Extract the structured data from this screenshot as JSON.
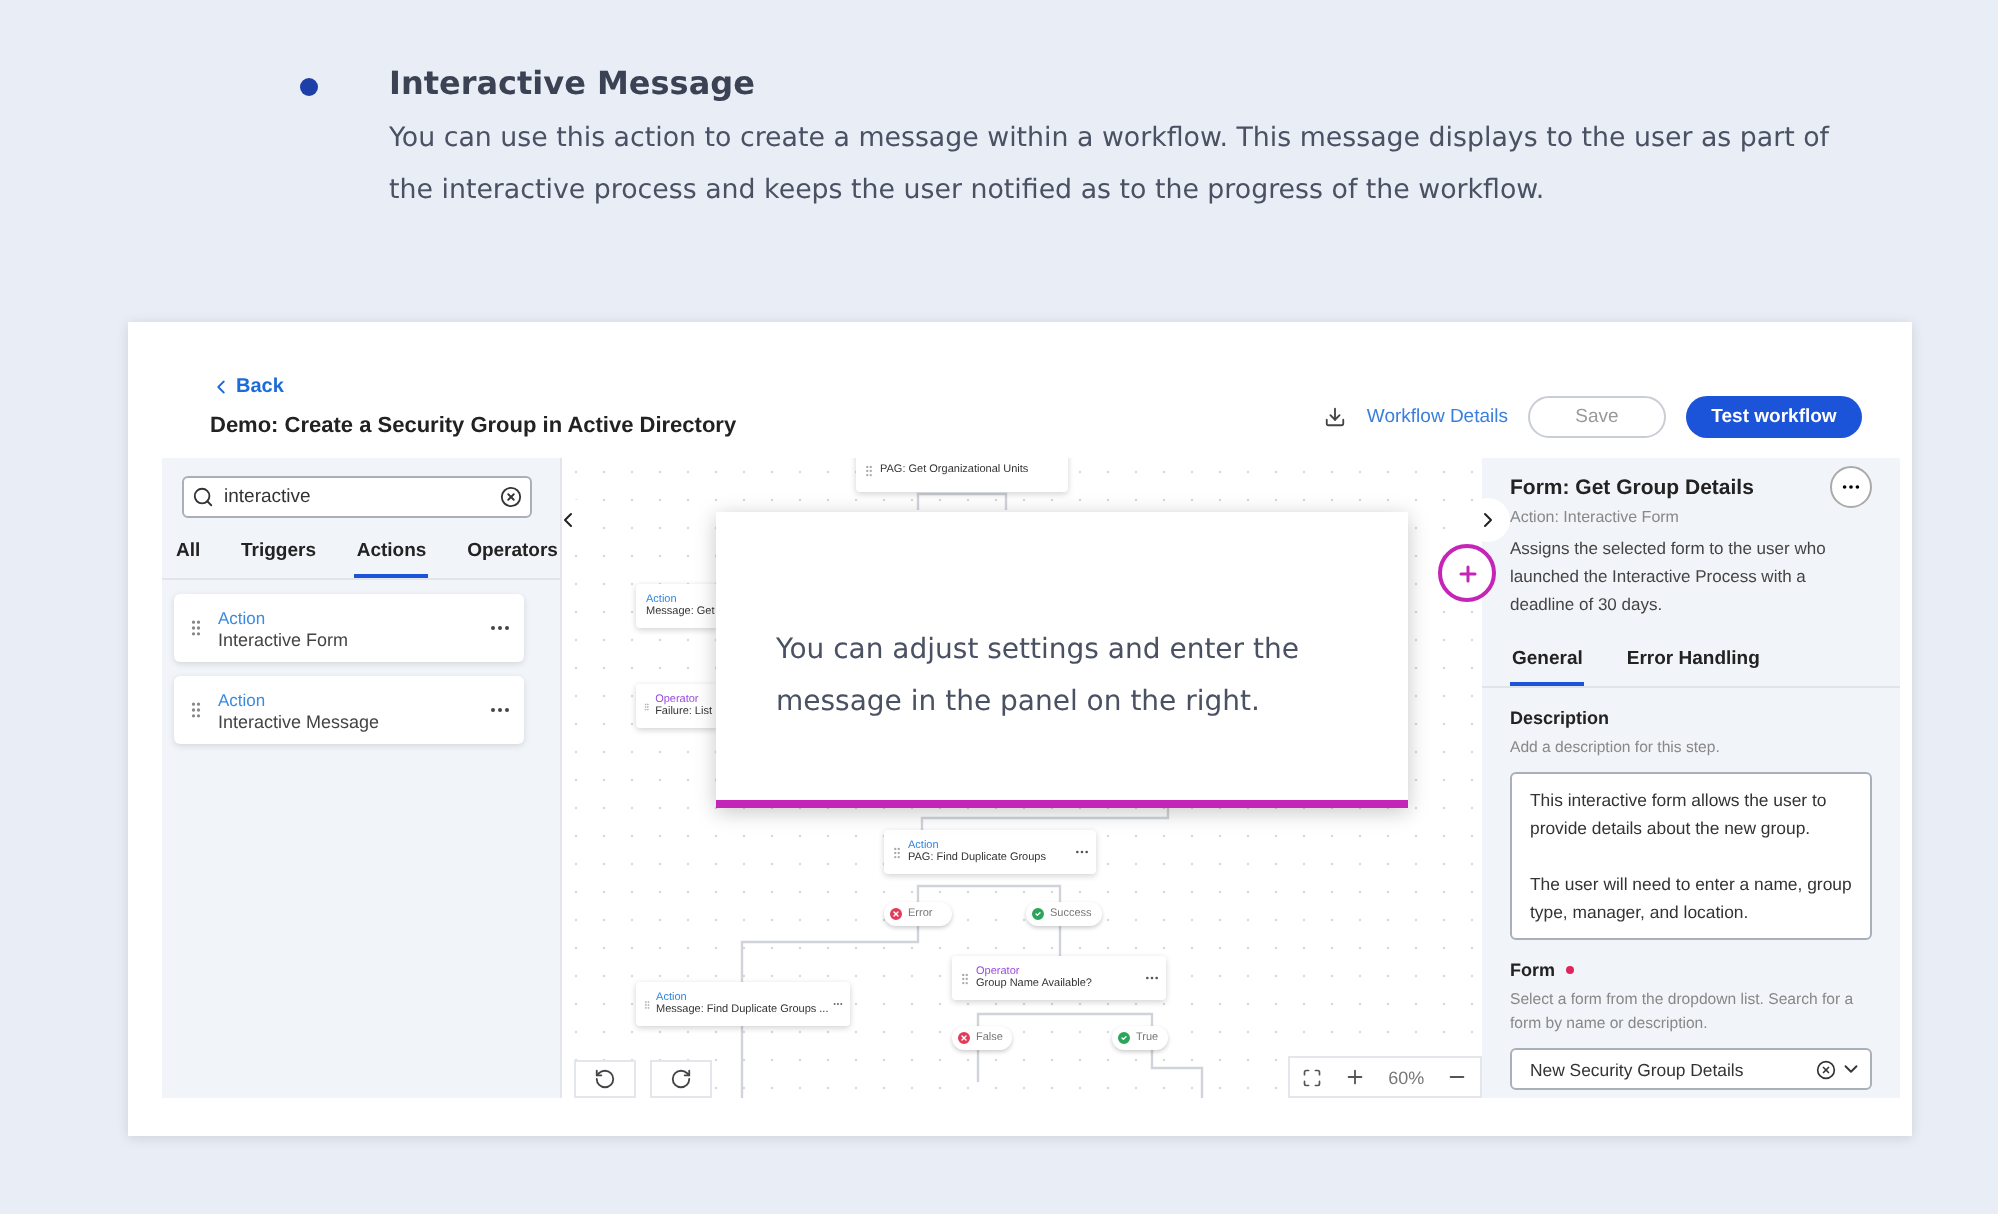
{
  "intro": {
    "title": "Interactive Message",
    "text": "You can use this action to create a message within a workflow. This message displays to the user as part of the interactive process and keeps the user notified as to the progress of the workflow."
  },
  "header": {
    "back": "Back",
    "title": "Demo: Create a Security Group in Active Directory",
    "details_link": "Workflow Details",
    "save": "Save",
    "test": "Test workflow"
  },
  "left_panel": {
    "search": {
      "value": "interactive"
    },
    "tabs": [
      {
        "label": "All",
        "selected": false
      },
      {
        "label": "Triggers",
        "selected": false
      },
      {
        "label": "Actions",
        "selected": true
      },
      {
        "label": "Operators",
        "selected": false
      }
    ],
    "items": [
      {
        "type": "Action",
        "name": "Interactive Form"
      },
      {
        "type": "Action",
        "name": "Interactive Message"
      }
    ]
  },
  "canvas": {
    "nodes": [
      {
        "kind": "plain",
        "name": "PAG: Get Organizational Units"
      },
      {
        "kind": "action",
        "type": "Action",
        "name": "Message: Get"
      },
      {
        "kind": "operator",
        "type": "Operator",
        "name": "Failure: List"
      },
      {
        "kind": "action",
        "type": "Action",
        "name": "PAG: Find Duplicate Groups"
      },
      {
        "kind": "operator",
        "type": "Operator",
        "name": "Group Name Available?"
      },
      {
        "kind": "action",
        "type": "Action",
        "name": "Message: Find Duplicate Groups ..."
      }
    ],
    "branches": [
      {
        "kind": "fail",
        "label": "Error"
      },
      {
        "kind": "pass",
        "label": "Success"
      },
      {
        "kind": "fail",
        "label": "False"
      },
      {
        "kind": "pass",
        "label": "True"
      }
    ],
    "zoom": "60%",
    "tooltip": "You can adjust settings and enter the message in the panel on the right."
  },
  "right_panel": {
    "title": "Form: Get Group Details",
    "subtitle": "Action: Interactive Form",
    "description": "Assigns the selected form to the user who launched the Interactive Process with a deadline of 30 days.",
    "tabs": [
      {
        "label": "General",
        "selected": true
      },
      {
        "label": "Error Handling",
        "selected": false
      }
    ],
    "fields": [
      {
        "label": "Description",
        "required": false,
        "hint": "Add a description for this step.",
        "kind": "textarea",
        "value": "This interactive form allows the user to provide details about the new group.\n\nThe user will need to enter a name, group type, manager, and location."
      },
      {
        "label": "Form",
        "required": true,
        "hint": "Select a form from the dropdown list. Search for a form by name or description.",
        "kind": "select",
        "value": "New Security Group Details"
      }
    ]
  }
}
